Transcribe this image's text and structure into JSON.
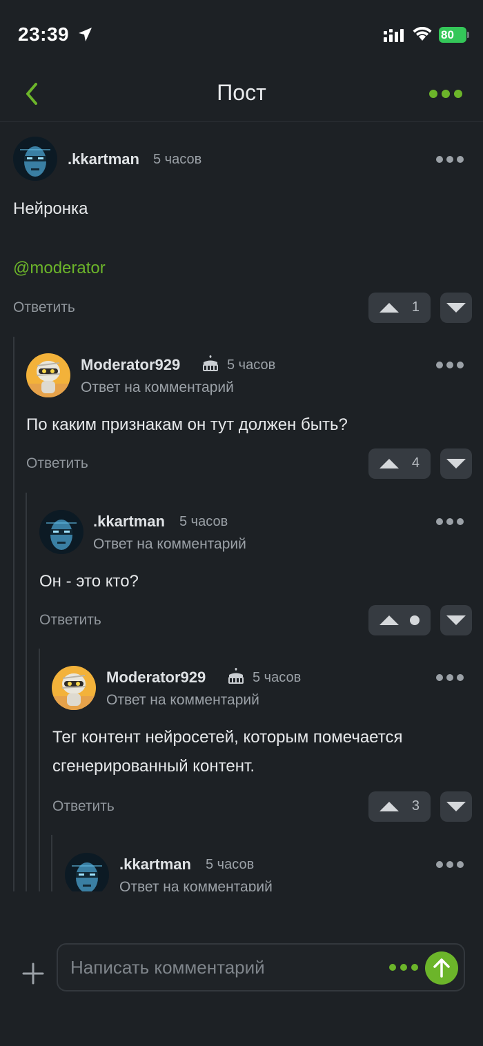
{
  "status_bar": {
    "time": "23:39",
    "battery": "80"
  },
  "nav": {
    "title": "Пост"
  },
  "comments": [
    {
      "username": ".kkartman",
      "time": "5 часов",
      "text": "Нейронка",
      "mention": "@moderator",
      "reply_label": "Ответить",
      "votes": "1"
    },
    {
      "username": "Moderator929",
      "time": "5 часов",
      "reply_to": "Ответ на комментарий",
      "text": "По каким признакам он тут должен быть?",
      "reply_label": "Ответить",
      "votes": "4"
    },
    {
      "username": ".kkartman",
      "time": "5 часов",
      "reply_to": "Ответ на комментарий",
      "text": "Он - это кто?",
      "reply_label": "Ответить",
      "votes": ""
    },
    {
      "username": "Moderator929",
      "time": "5 часов",
      "reply_to": "Ответ на комментарий",
      "text": "Тег контент нейросетей, которым помечается сгенерированный контент.",
      "reply_label": "Ответить",
      "votes": "3"
    },
    {
      "username": ".kkartman",
      "time": "5 часов",
      "reply_to": "Ответ на комментарий"
    }
  ],
  "composer": {
    "placeholder": "Написать комментарий"
  },
  "colors": {
    "accent": "#6cb52a",
    "background": "#1d2125",
    "button": "#363b41"
  }
}
